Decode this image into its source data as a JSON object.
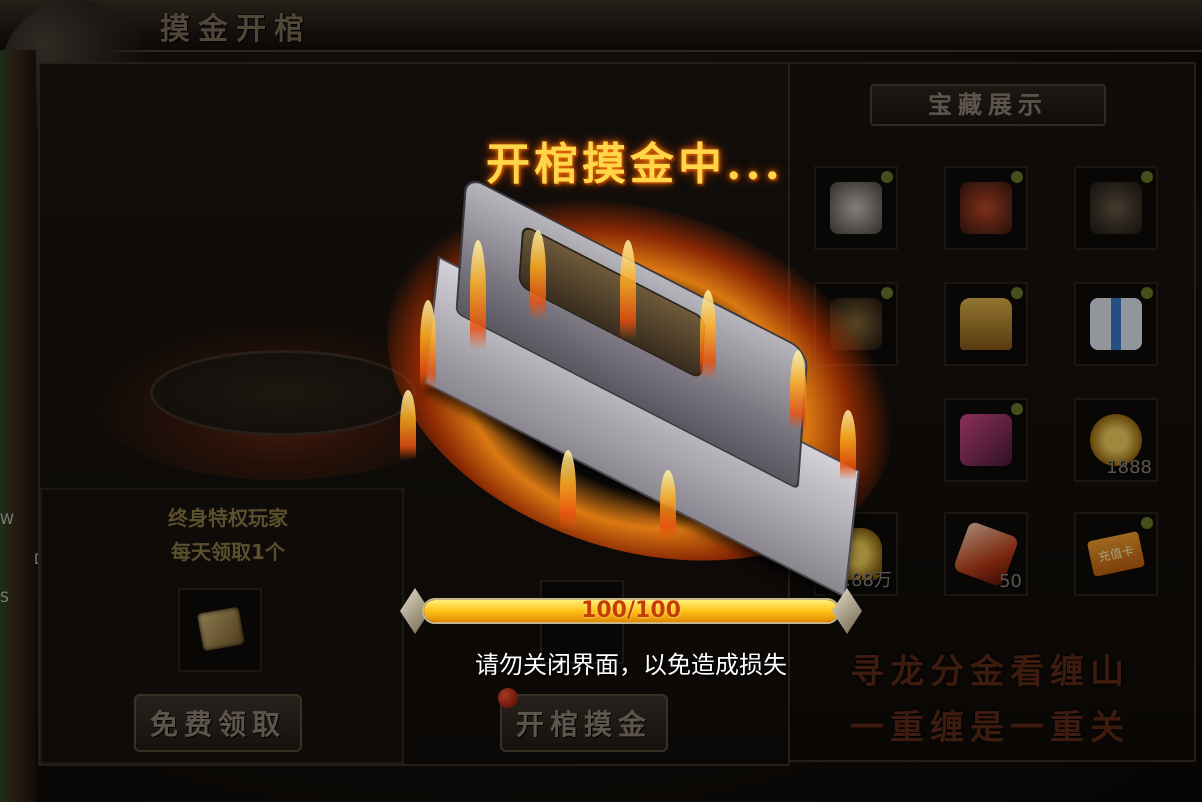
{
  "window": {
    "title": "摸金开棺"
  },
  "left_edge": {
    "letters": [
      "W",
      "D",
      "S"
    ]
  },
  "left_section": {
    "privilege_line1": "终身特权玩家",
    "privilege_line2": "每天领取1个",
    "reward_item": "scroll-icon",
    "free_claim_button": "免费领取",
    "open_coffin_button": "开棺摸金"
  },
  "treasure": {
    "banner": "宝藏展示",
    "items": [
      {
        "icon": "white-beast-icon",
        "qty": ""
      },
      {
        "icon": "red-armor-beast-icon",
        "qty": ""
      },
      {
        "icon": "dark-beast-icon",
        "qty": ""
      },
      {
        "icon": "armored-warrior-icon",
        "qty": ""
      },
      {
        "icon": "treasure-chest-icon",
        "qty": ""
      },
      {
        "icon": "gift-box-icon",
        "qty": ""
      },
      {
        "icon": "empty-icon",
        "qty": ""
      },
      {
        "icon": "magic-box-icon",
        "qty": ""
      },
      {
        "icon": "gold-coins-icon",
        "qty": "1888"
      },
      {
        "icon": "gold-ingot-icon",
        "qty": "8.88万"
      },
      {
        "icon": "red-crystal-icon",
        "qty": "50"
      },
      {
        "icon": "recharge-card-icon",
        "qty": "充值卡"
      }
    ],
    "slogan_line1": "寻龙分金看缠山",
    "slogan_line2": "一重缠是一重关"
  },
  "overlay": {
    "status_title": "开棺摸金中...",
    "progress_text": "100/100",
    "progress_fraction": 1.0,
    "warning": "请勿关闭界面，以免造成损失"
  },
  "colors": {
    "gold": "#ffd54a",
    "fire": "#ff7a00",
    "progress": "#ffc21a"
  }
}
